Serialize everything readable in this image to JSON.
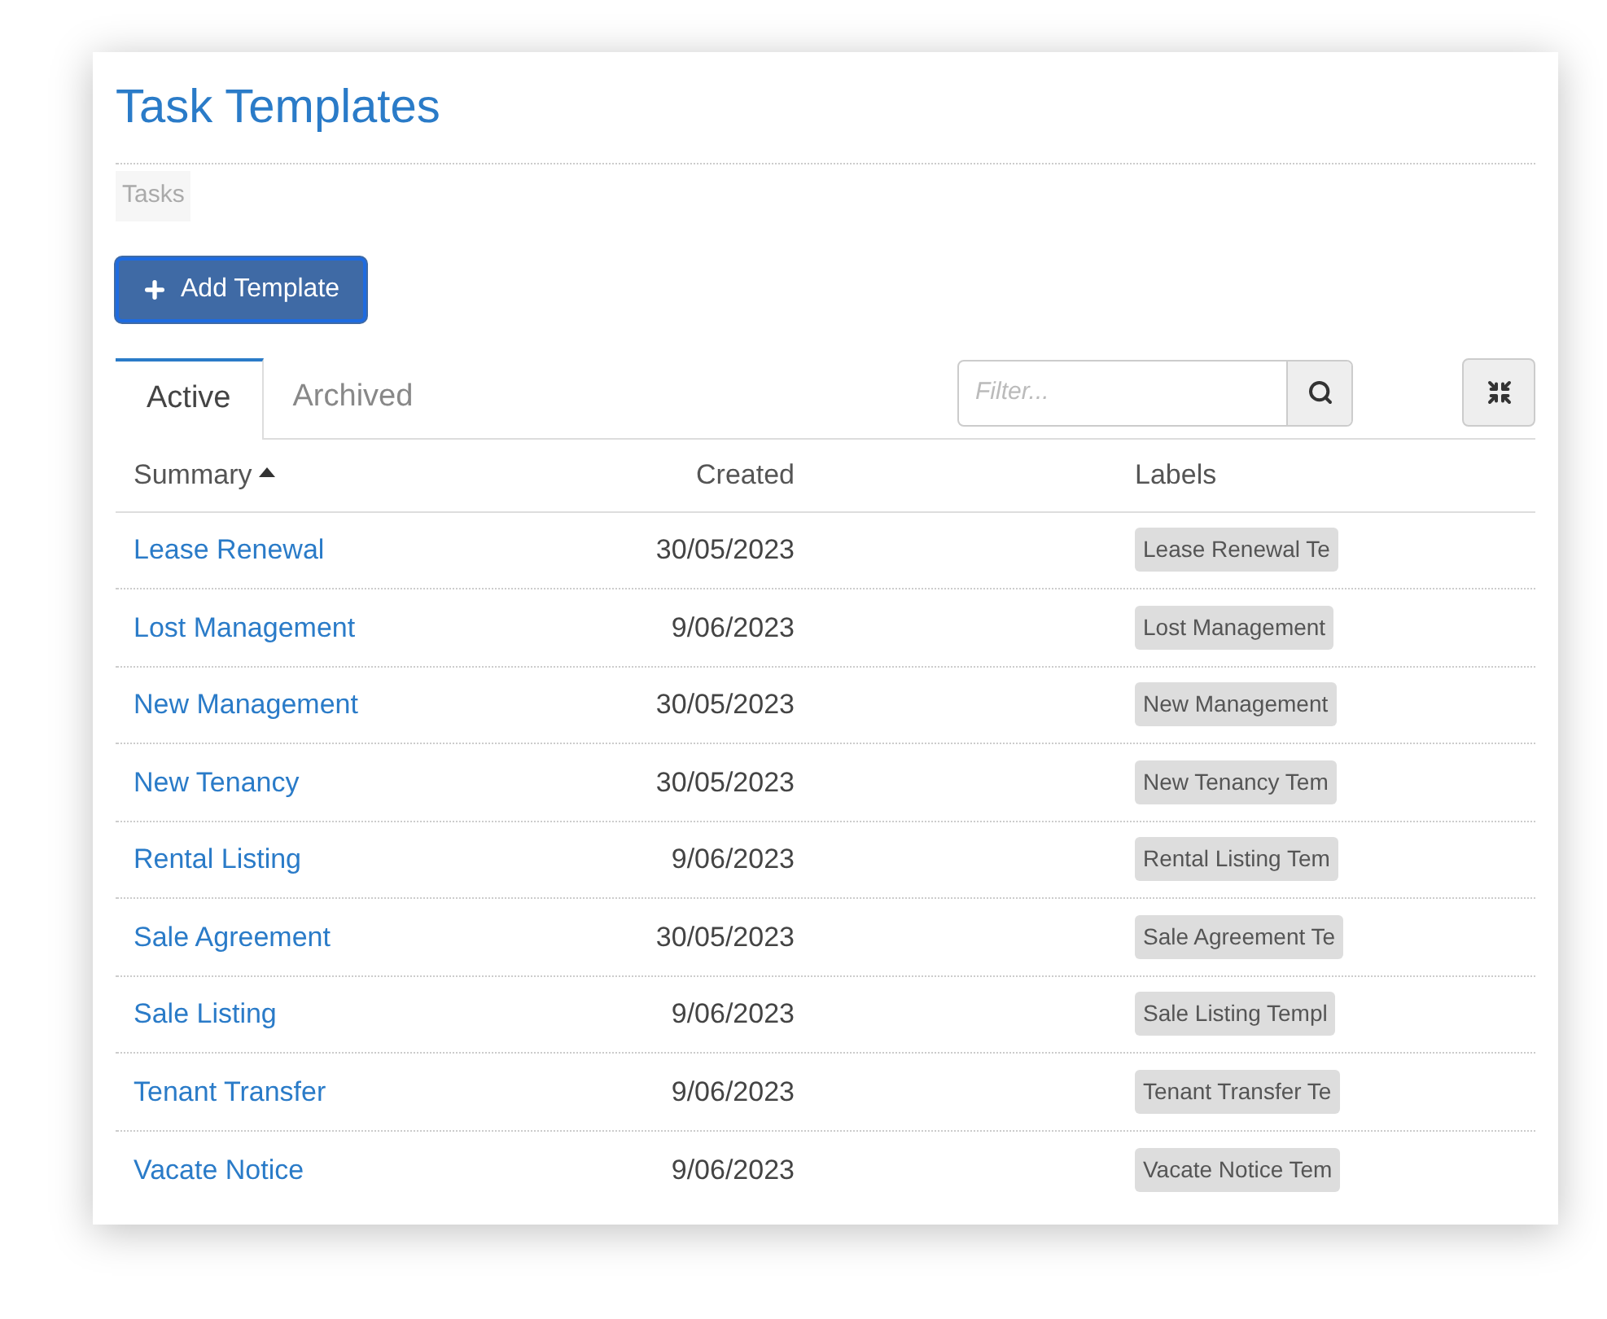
{
  "title": "Task Templates",
  "breadcrumb": [
    "Tasks"
  ],
  "add_button": {
    "label": "Add Template"
  },
  "tabs": [
    {
      "label": "Active",
      "selected": true
    },
    {
      "label": "Archived",
      "selected": false
    }
  ],
  "filter": {
    "placeholder": "Filter..."
  },
  "table": {
    "columns": [
      {
        "label": "Summary",
        "sorted": true
      },
      {
        "label": "Created",
        "sorted": false
      },
      {
        "label": "Labels",
        "sorted": false
      }
    ],
    "rows": [
      {
        "summary": "Lease Renewal",
        "created": "30/05/2023",
        "label": "Lease Renewal Te"
      },
      {
        "summary": "Lost Management",
        "created": "9/06/2023",
        "label": "Lost Management"
      },
      {
        "summary": "New Management",
        "created": "30/05/2023",
        "label": "New Management"
      },
      {
        "summary": "New Tenancy",
        "created": "30/05/2023",
        "label": "New Tenancy Tem"
      },
      {
        "summary": "Rental Listing",
        "created": "9/06/2023",
        "label": "Rental Listing Tem"
      },
      {
        "summary": "Sale Agreement",
        "created": "30/05/2023",
        "label": "Sale Agreement Te"
      },
      {
        "summary": "Sale Listing",
        "created": "9/06/2023",
        "label": "Sale Listing Templ"
      },
      {
        "summary": "Tenant Transfer",
        "created": "9/06/2023",
        "label": "Tenant Transfer Te"
      },
      {
        "summary": "Vacate Notice",
        "created": "9/06/2023",
        "label": "Vacate Notice Tem"
      }
    ]
  }
}
